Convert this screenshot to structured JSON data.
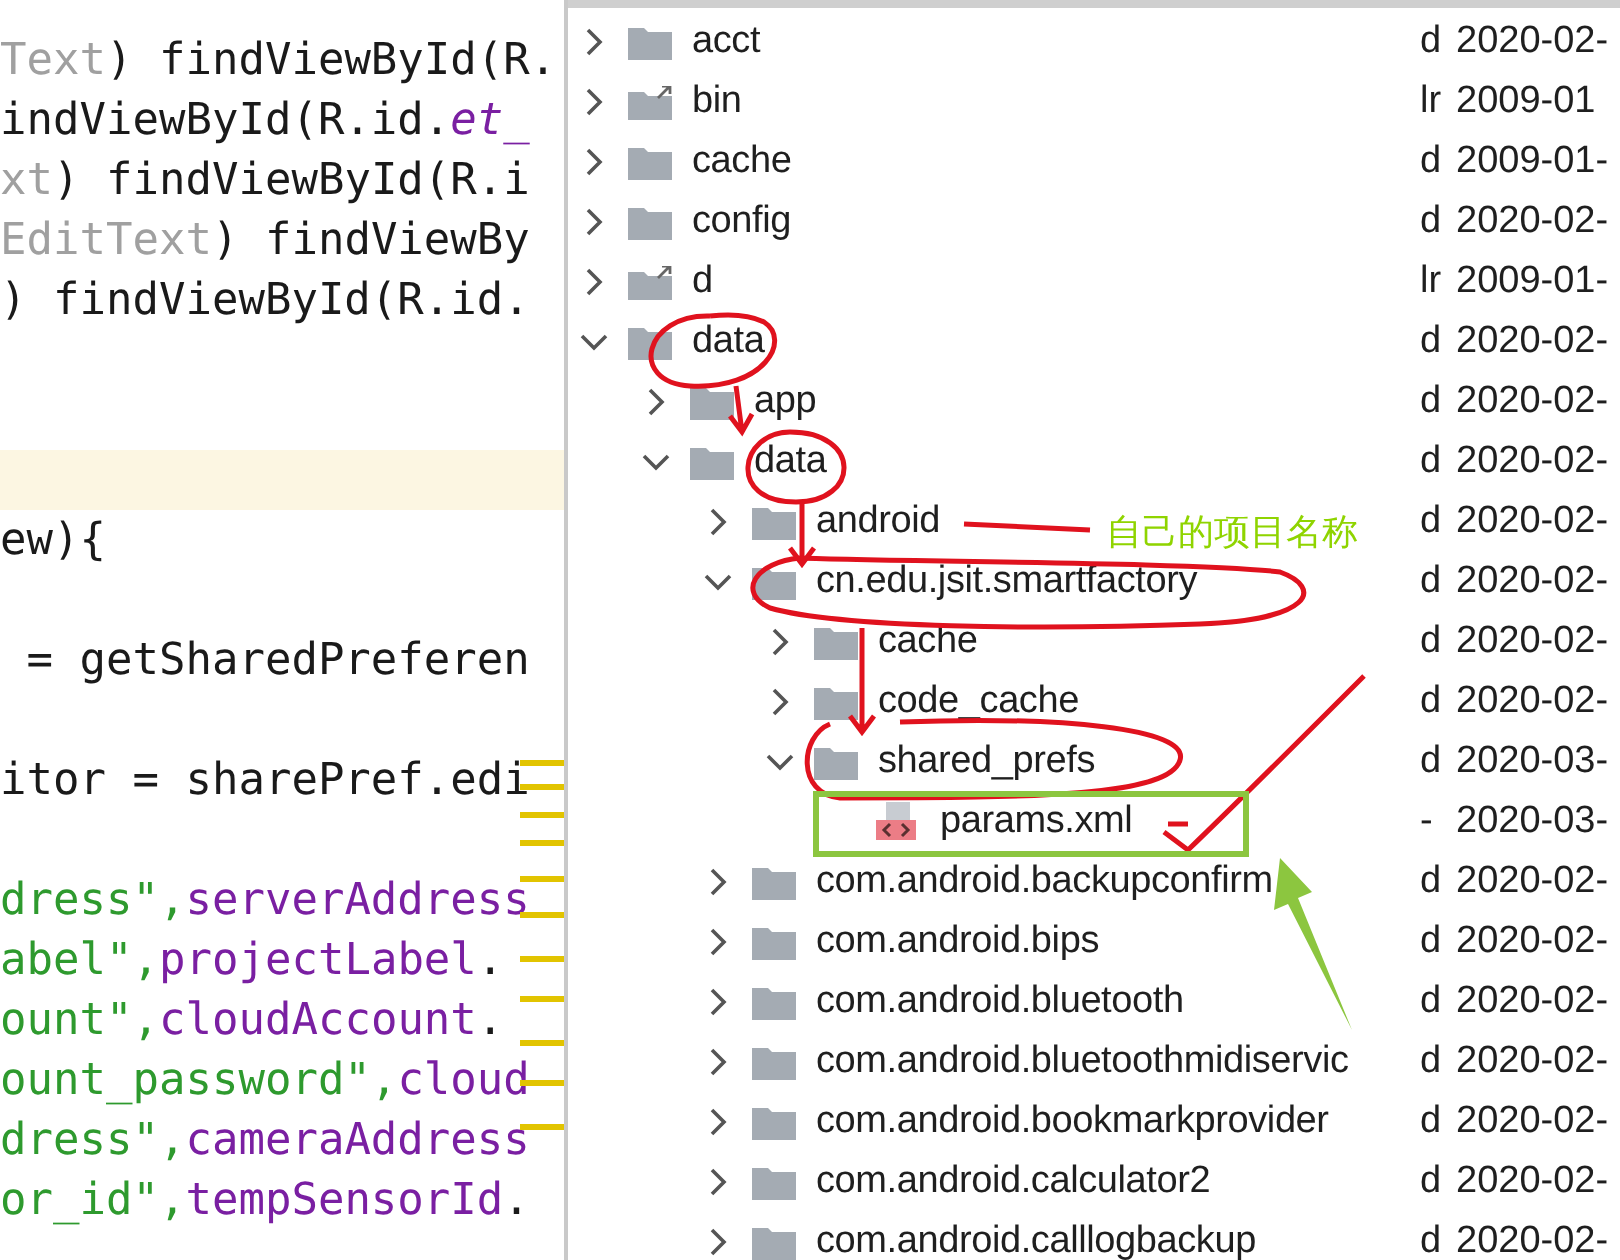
{
  "code": {
    "lines": [
      {
        "highlighted": false,
        "segments": [
          {
            "kind": "muted",
            "text": "Text"
          },
          {
            "kind": "plain",
            "text": ") findViewById(R."
          }
        ]
      },
      {
        "highlighted": false,
        "segments": [
          {
            "kind": "plain",
            "text": "indViewById(R.id."
          },
          {
            "kind": "id",
            "text": "et_"
          }
        ]
      },
      {
        "highlighted": false,
        "segments": [
          {
            "kind": "muted",
            "text": "xt"
          },
          {
            "kind": "plain",
            "text": ") findViewById(R.i"
          }
        ]
      },
      {
        "highlighted": false,
        "segments": [
          {
            "kind": "muted",
            "text": "EditText"
          },
          {
            "kind": "plain",
            "text": ") findViewBy"
          }
        ]
      },
      {
        "highlighted": false,
        "segments": [
          {
            "kind": "plain",
            "text": ") findViewById(R.id."
          }
        ]
      },
      {
        "highlighted": false
      },
      {
        "highlighted": false
      },
      {
        "highlighted": true
      },
      {
        "highlighted": false,
        "segments": [
          {
            "kind": "plain",
            "text": "ew){"
          }
        ]
      },
      {
        "highlighted": false
      },
      {
        "highlighted": false,
        "segments": [
          {
            "kind": "plain",
            "text": " = getSharedPreferen"
          }
        ]
      },
      {
        "highlighted": false
      },
      {
        "highlighted": false,
        "segments": [
          {
            "kind": "plain",
            "text": "itor = sharePref.edi"
          }
        ]
      },
      {
        "highlighted": false
      },
      {
        "highlighted": false,
        "segments": [
          {
            "kind": "string",
            "text": "dress\","
          },
          {
            "kind": "field",
            "text": "serverAddress"
          }
        ]
      },
      {
        "highlighted": false,
        "segments": [
          {
            "kind": "string",
            "text": "abel\","
          },
          {
            "kind": "field",
            "text": "projectLabel"
          },
          {
            "kind": "plain",
            "text": "."
          }
        ]
      },
      {
        "highlighted": false,
        "segments": [
          {
            "kind": "string",
            "text": "ount\","
          },
          {
            "kind": "field",
            "text": "cloudAccount"
          },
          {
            "kind": "plain",
            "text": "."
          }
        ]
      },
      {
        "highlighted": false,
        "segments": [
          {
            "kind": "string",
            "text": "ount_password\","
          },
          {
            "kind": "field",
            "text": "cloud"
          }
        ]
      },
      {
        "highlighted": false,
        "segments": [
          {
            "kind": "string",
            "text": "dress\","
          },
          {
            "kind": "field",
            "text": "cameraAddress"
          }
        ]
      },
      {
        "highlighted": false,
        "segments": [
          {
            "kind": "string",
            "text": "or_id\","
          },
          {
            "kind": "field",
            "text": "tempSensorId"
          },
          {
            "kind": "plain",
            "text": "."
          }
        ]
      }
    ]
  },
  "file_tree": [
    {
      "name": "acct",
      "kind": "folder",
      "expanded": false,
      "permissions": "d",
      "date": "2020-02-"
    },
    {
      "name": "bin",
      "kind": "link",
      "expanded": false,
      "permissions": "lr",
      "date": "2009-01"
    },
    {
      "name": "cache",
      "kind": "folder",
      "expanded": false,
      "permissions": "d",
      "date": "2009-01-"
    },
    {
      "name": "config",
      "kind": "folder",
      "expanded": false,
      "permissions": "d",
      "date": "2020-02-"
    },
    {
      "name": "d",
      "kind": "link",
      "expanded": false,
      "permissions": "lr",
      "date": "2009-01-"
    },
    {
      "name": "data",
      "kind": "folder",
      "expanded": true,
      "permissions": "d",
      "date": "2020-02-",
      "children": [
        {
          "name": "app",
          "kind": "folder",
          "expanded": false,
          "permissions": "d",
          "date": "2020-02-"
        },
        {
          "name": "data",
          "kind": "folder",
          "expanded": true,
          "permissions": "d",
          "date": "2020-02-",
          "children": [
            {
              "name": "android",
              "kind": "folder",
              "expanded": false,
              "permissions": "d",
              "date": "2020-02-"
            },
            {
              "name": "cn.edu.jsit.smartfactory",
              "kind": "folder",
              "expanded": true,
              "permissions": "d",
              "date": "2020-02-",
              "children": [
                {
                  "name": "cache",
                  "kind": "folder",
                  "expanded": false,
                  "permissions": "d",
                  "date": "2020-02-"
                },
                {
                  "name": "code_cache",
                  "kind": "folder",
                  "expanded": false,
                  "permissions": "d",
                  "date": "2020-02-"
                },
                {
                  "name": "shared_prefs",
                  "kind": "folder",
                  "expanded": true,
                  "permissions": "d",
                  "date": "2020-03-",
                  "children": [
                    {
                      "name": "params.xml",
                      "kind": "file",
                      "permissions": "-",
                      "date": "2020-03-"
                    }
                  ]
                }
              ]
            },
            {
              "name": "com.android.backupconfirm",
              "kind": "folder",
              "expanded": false,
              "permissions": "d",
              "date": "2020-02-"
            },
            {
              "name": "com.android.bips",
              "kind": "folder",
              "expanded": false,
              "permissions": "d",
              "date": "2020-02-"
            },
            {
              "name": "com.android.bluetooth",
              "kind": "folder",
              "expanded": false,
              "permissions": "d",
              "date": "2020-02-"
            },
            {
              "name": "com.android.bluetoothmidiservic",
              "kind": "folder",
              "expanded": false,
              "permissions": "d",
              "date": "2020-02-"
            },
            {
              "name": "com.android.bookmarkprovider",
              "kind": "folder",
              "expanded": false,
              "permissions": "d",
              "date": "2020-02-"
            },
            {
              "name": "com.android.calculator2",
              "kind": "folder",
              "expanded": false,
              "permissions": "d",
              "date": "2020-02-"
            },
            {
              "name": "com.android.calllogbackup",
              "kind": "folder",
              "expanded": false,
              "permissions": "d",
              "date": "2020-02-"
            }
          ]
        }
      ]
    }
  ],
  "annotation_label": "自己的项目名称"
}
